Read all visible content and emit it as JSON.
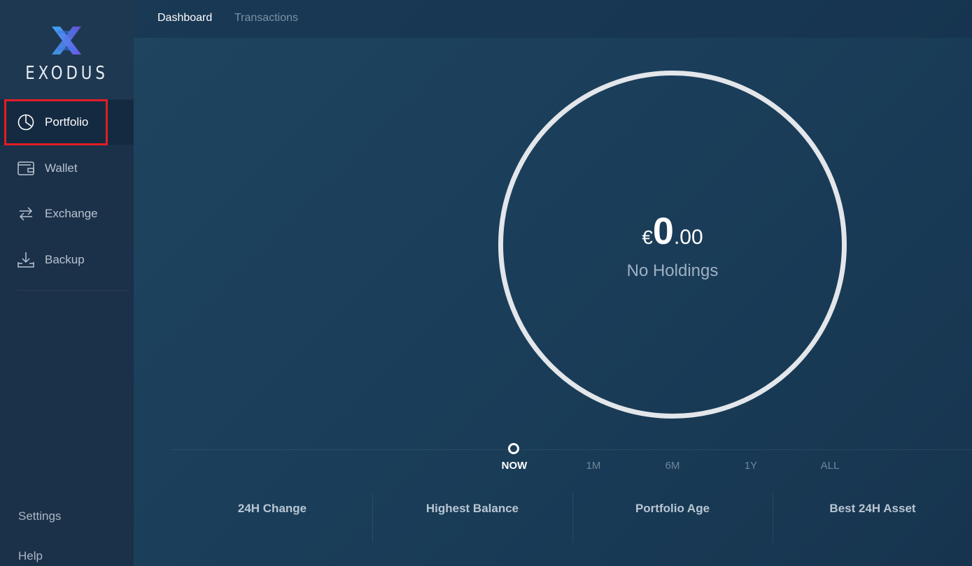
{
  "app": {
    "brand": "EXODUS"
  },
  "sidebar": {
    "items": [
      {
        "label": "Portfolio",
        "icon": "pie-chart-icon",
        "active": true
      },
      {
        "label": "Wallet",
        "icon": "wallet-icon",
        "active": false
      },
      {
        "label": "Exchange",
        "icon": "exchange-arrows-icon",
        "active": false
      },
      {
        "label": "Backup",
        "icon": "download-tray-icon",
        "active": false
      }
    ],
    "settings_label": "Settings",
    "help_label": "Help"
  },
  "header": {
    "tabs": [
      {
        "label": "Dashboard",
        "active": true
      },
      {
        "label": "Transactions",
        "active": false
      }
    ]
  },
  "portfolio": {
    "currency_symbol": "€",
    "balance_integer": "0",
    "balance_decimal": ".00",
    "status_text": "No Holdings"
  },
  "timeline": {
    "ranges": [
      "NOW",
      "1M",
      "6M",
      "1Y",
      "ALL"
    ],
    "selected": "NOW"
  },
  "stats": [
    {
      "label": "24H Change"
    },
    {
      "label": "Highest Balance"
    },
    {
      "label": "Portfolio Age"
    },
    {
      "label": "Best 24H Asset"
    }
  ],
  "colors": {
    "highlight": "#e21d25",
    "ring": "#e3e6ea",
    "logo_blue": "#3fa3f0",
    "logo_purple": "#6b57e6"
  }
}
